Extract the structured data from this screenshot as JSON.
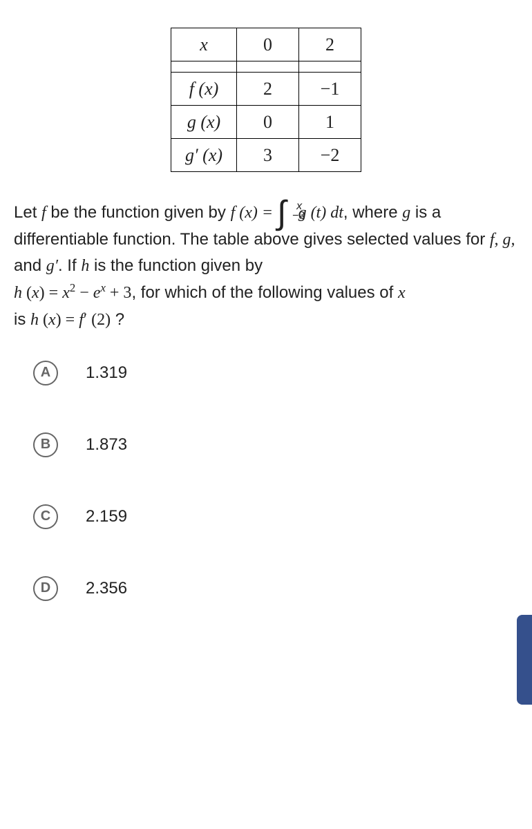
{
  "table": {
    "headers": [
      "x",
      "0",
      "2"
    ],
    "rows": [
      {
        "label": "f (x)",
        "v1": "2",
        "v2": "−1"
      },
      {
        "label": "g (x)",
        "v1": "0",
        "v2": "1"
      },
      {
        "label": "g′ (x)",
        "v1": "3",
        "v2": "−2"
      }
    ]
  },
  "question": {
    "part1": "Let ",
    "f1": "f",
    "part2": " be the function given by ",
    "eq1_lhs": "f (x) = ",
    "int_lower": "−3",
    "int_upper": "x",
    "integrand": "g (t) dt",
    "part3": ", where ",
    "g1": "g",
    "part4": " is a differentiable function. The table above gives selected values for ",
    "fgh": "f, g,",
    "part5": " and ",
    "gprime": "g′",
    "part6": ". If ",
    "h1": "h",
    "part7": " is the function given by ",
    "h_eq": "h (x) = x² − eˣ + 3",
    "part8": ", for which of the following values of ",
    "x1": "x",
    "part9": " is ",
    "final_eq": "h (x) = f′ (2)",
    "part10": " ?"
  },
  "choices": [
    {
      "letter": "A",
      "text": "1.319"
    },
    {
      "letter": "B",
      "text": "1.873"
    },
    {
      "letter": "C",
      "text": "2.159"
    },
    {
      "letter": "D",
      "text": "2.356"
    }
  ]
}
